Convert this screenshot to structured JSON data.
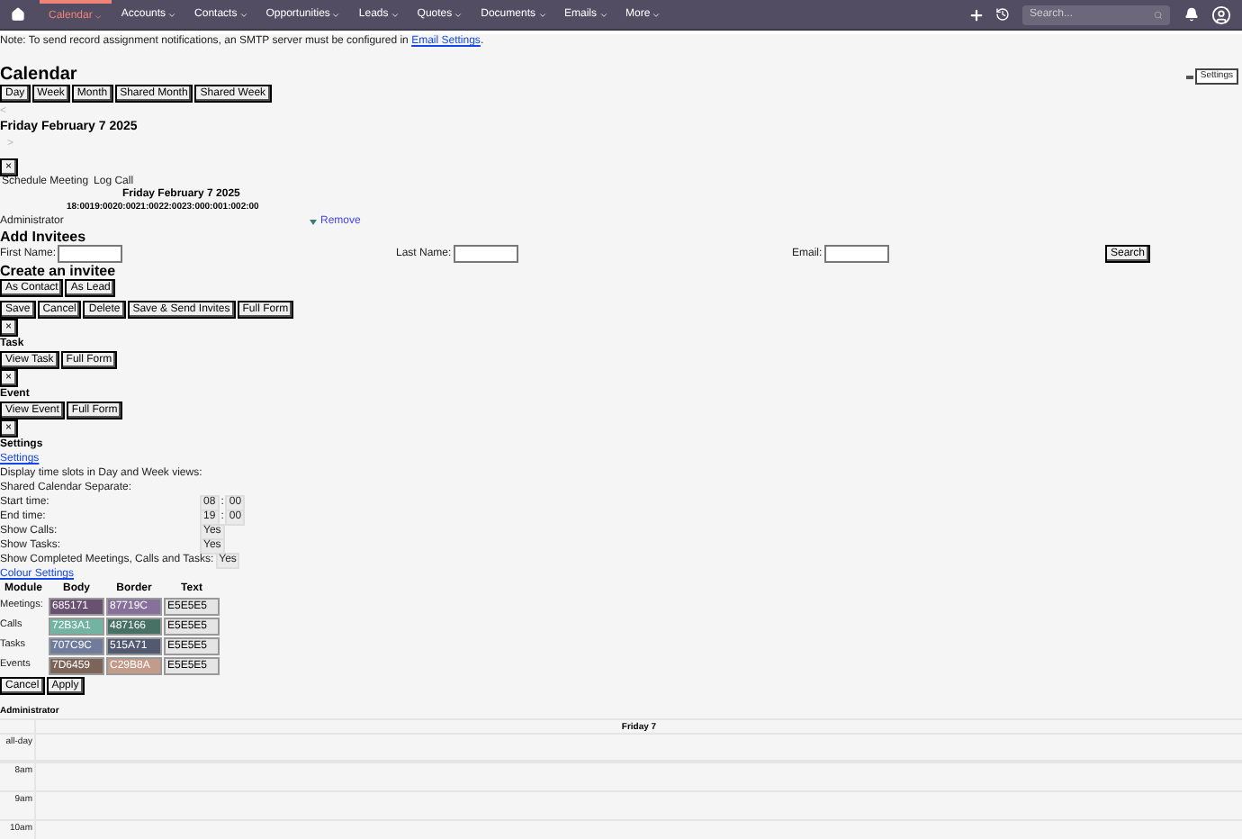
{
  "nav": {
    "items": [
      {
        "label": "Calendar",
        "selected": true
      },
      {
        "label": "Accounts",
        "selected": false
      },
      {
        "label": "Contacts",
        "selected": false
      },
      {
        "label": "Opportunities",
        "selected": false
      },
      {
        "label": "Leads",
        "selected": false
      },
      {
        "label": "Quotes",
        "selected": false
      },
      {
        "label": "Documents",
        "selected": false
      },
      {
        "label": "Emails",
        "selected": false
      },
      {
        "label": "More",
        "selected": false
      }
    ],
    "search": {
      "placeholder": "Search..."
    }
  },
  "note": {
    "text": "Note: To send record assignment notifications, an SMTP server must be configured in",
    "link": "Email Settings",
    "end": "."
  },
  "title": "Calendar",
  "settings_button": "Settings",
  "views": [
    "Day",
    "Week",
    "Month",
    "Shared Month",
    "Shared Week"
  ],
  "prev": "<",
  "date": "Friday February 7 2025",
  "next": ">",
  "close": "×",
  "dialog": {
    "tabs": [
      "Schedule Meeting",
      "Log Call"
    ],
    "date": "Friday February 7 2025",
    "hours": [
      "18:00",
      "19:00",
      "20:00",
      "21:00",
      "22:00",
      "23:00",
      "0:00",
      "1:00",
      "2:00"
    ],
    "user": "Administrator",
    "remove": "Remove",
    "add_invitees": "Add Invitees",
    "fields": [
      {
        "label": "First Name:"
      },
      {
        "label": "Last Name:"
      },
      {
        "label": "Email:"
      }
    ],
    "search": "Search",
    "create": "Create an invitee",
    "create_buttons": [
      "As Contact",
      "As Lead"
    ],
    "actions": [
      "Save",
      "Cancel",
      "Delete",
      "Save & Send Invites",
      "Full Form"
    ]
  },
  "task": {
    "close": "×",
    "title": "Task",
    "buttons": [
      "View Task",
      "Full Form"
    ]
  },
  "event": {
    "close": "×",
    "title": "Event",
    "buttons": [
      "View Event",
      "Full Form"
    ]
  },
  "settings": {
    "close": "×",
    "title": "Settings",
    "link": "Settings",
    "lines": [
      "Display time slots in Day and Week views:",
      "Shared Calendar Separate:"
    ],
    "rows": [
      {
        "label": "Start time:",
        "kind": "time",
        "h": "08",
        "sep": ":",
        "m": "00"
      },
      {
        "label": "End time:",
        "kind": "time",
        "h": "19",
        "sep": ":",
        "m": "00"
      },
      {
        "label": "Show Calls:",
        "kind": "select",
        "value": "Yes"
      },
      {
        "label": "Show Tasks:",
        "kind": "select",
        "value": "Yes"
      },
      {
        "label": "Show Completed Meetings, Calls and Tasks:",
        "kind": "select",
        "value": "Yes"
      }
    ],
    "colour_link": "Colour Settings",
    "columns": [
      "Module",
      "Body",
      "Border",
      "Text"
    ],
    "modules": [
      {
        "name": "Meetings:",
        "body": "685171",
        "border": "87719C",
        "text": "E5E5E5"
      },
      {
        "name": "Calls",
        "body": "72B3A1",
        "border": "487166",
        "text": "E5E5E5"
      },
      {
        "name": "Tasks",
        "body": "707C9C",
        "border": "515A71",
        "text": "E5E5E5"
      },
      {
        "name": "Events",
        "body": "7D6459",
        "border": "C29B8A",
        "text": "E5E5E5"
      }
    ],
    "buttons": [
      "Cancel",
      "Apply"
    ]
  },
  "day_view": {
    "user": "Administrator",
    "day": "Friday 7",
    "rows": [
      "all-day",
      "8am",
      "9am",
      "10am"
    ]
  }
}
